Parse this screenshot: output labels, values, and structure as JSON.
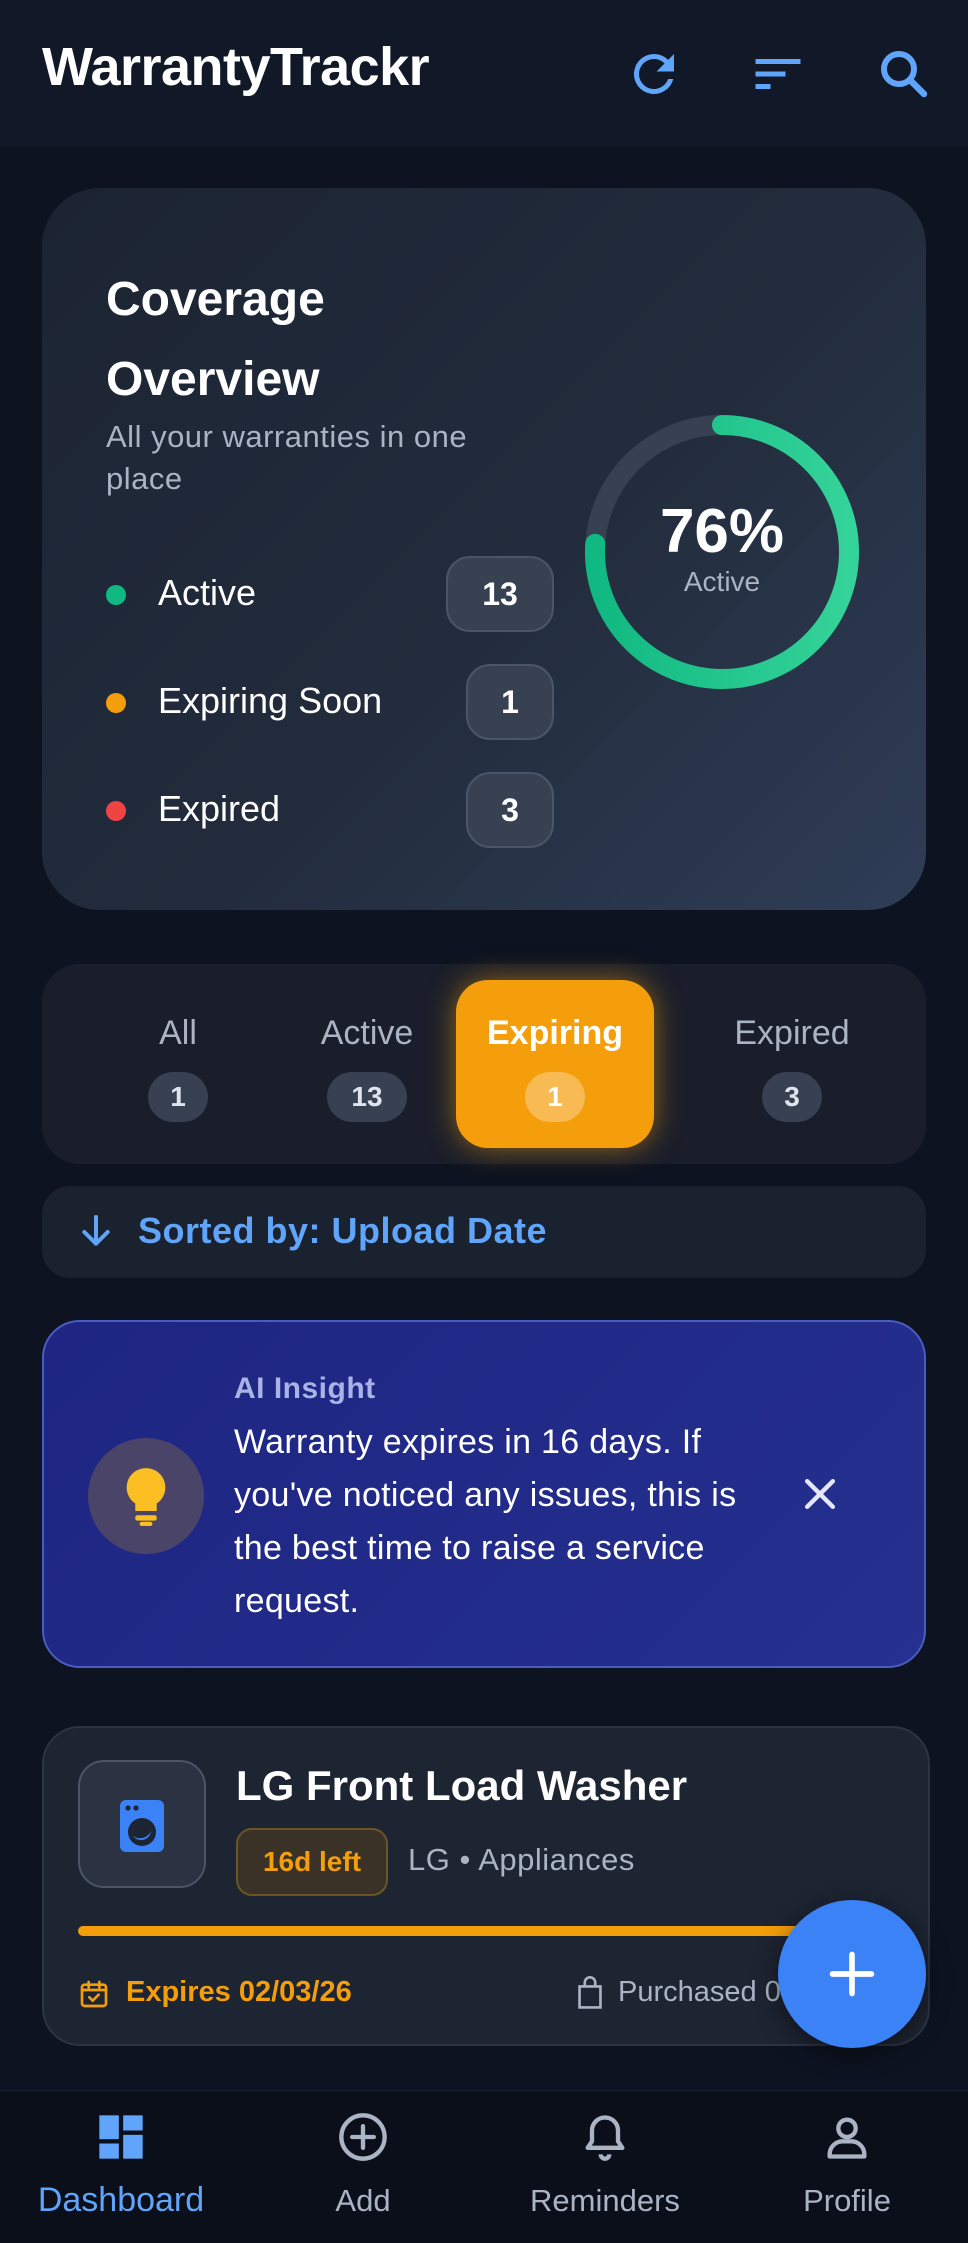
{
  "app": {
    "title": "WarrantyTrackr"
  },
  "header": {
    "icons": [
      "refresh-icon",
      "sort-icon",
      "search-icon"
    ],
    "accent": "#60a5fa"
  },
  "overview": {
    "title": "Coverage Overview",
    "subtitle": "All your warranties in one place",
    "stats": [
      {
        "label": "Active",
        "count": "13",
        "color": "#10b981"
      },
      {
        "label": "Expiring Soon",
        "count": "1",
        "color": "#f59e0b"
      },
      {
        "label": "Expired",
        "count": "3",
        "color": "#ef4444"
      }
    ],
    "coverage": {
      "percent_text": "76%",
      "percent": 76,
      "label": "Active"
    }
  },
  "filters": [
    {
      "label": "All",
      "count": "1",
      "selected": false
    },
    {
      "label": "Active",
      "count": "13",
      "selected": false
    },
    {
      "label": "Expiring",
      "count": "1",
      "selected": true
    },
    {
      "label": "Expired",
      "count": "3",
      "selected": false
    }
  ],
  "sort": {
    "label": "Sorted by: Upload Date"
  },
  "insight": {
    "heading": "AI Insight",
    "text": "Warranty expires in 16 days. If you've noticed any issues, this is the best time to raise a service request."
  },
  "items": [
    {
      "name": "LG Front Load Washer",
      "days_left": "16d left",
      "meta": "LG • Appliances",
      "progress": 0.9,
      "expires": "Expires 02/03/26",
      "purchased": "Purchased 0",
      "icon": "washing-machine-icon"
    }
  ],
  "nav": [
    {
      "label": "Dashboard",
      "icon": "dashboard-icon",
      "active": true
    },
    {
      "label": "Add",
      "icon": "add-circle-icon",
      "active": false
    },
    {
      "label": "Reminders",
      "icon": "bell-icon",
      "active": false
    },
    {
      "label": "Profile",
      "icon": "profile-icon",
      "active": false
    }
  ],
  "colors": {
    "background": "#0d1320",
    "accent_blue": "#3b82f6",
    "warning": "#f59e0b",
    "success": "#10b981",
    "danger": "#ef4444"
  }
}
